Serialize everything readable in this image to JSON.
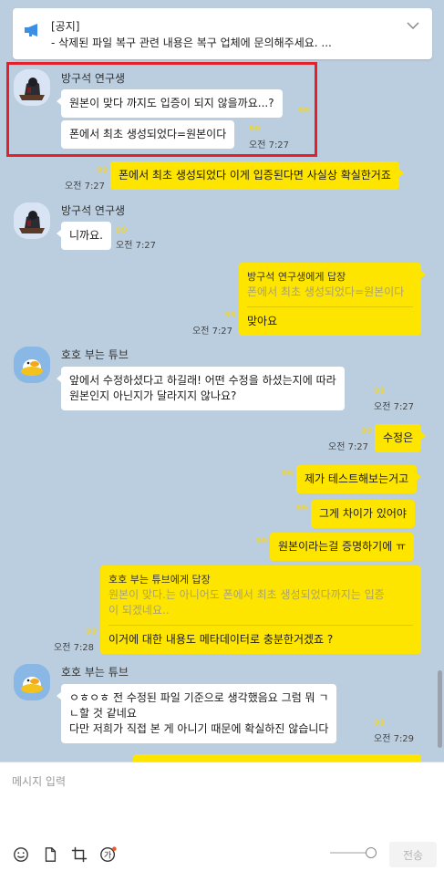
{
  "notice": {
    "title": "[공지]",
    "text": "- 삭제된 파일 복구 관련 내용은 복구 업체에 문의해주세요. ..."
  },
  "users": {
    "a": "방구석 연구생",
    "b": "호호 부는 튜브"
  },
  "unread_mark": "99",
  "messages": {
    "m1": "원본이 맞다 까지도 입증이 되지 않을까요...?",
    "m2": "폰에서 최초 생성되었다=원본이다",
    "m2_time": "오전 7:27",
    "m3": "폰에서 최초 생성되었다 이게 입증된다면 사실상 확실한거죠",
    "m3_time": "오전 7:27",
    "m4": "니까요.",
    "m4_time": "오전 7:27",
    "m5_reply_title": "방구석 연구생에게 답장",
    "m5_reply_quote": "폰에서 최초 생성되었다=원본이다",
    "m5_body": "맞아요",
    "m5_time": "오전 7:27",
    "m6_line1": "앞에서 수정하셨다고 하길래! 어떤 수정을 하셨는지에 따라",
    "m6_line2": "원본인지 아닌지가 달라지지 않나요?",
    "m6_time": "오전 7:27",
    "m7": "수정은",
    "m7_time": "오전 7:27",
    "m8": "제가 테스트해보는거고",
    "m9": "그게 차이가 있어야",
    "m10": "원본이라는걸 증명하기에 ㅠ",
    "m11_reply_title": "호호 부는 튜브에게 답장",
    "m11_reply_quote1": "원본이 맞다.는 아니어도 폰에서 최초 생성되었다까지는 입증",
    "m11_reply_quote2": "이 되겠네요..",
    "m11_body": "이거에 대한 내용도 메타데이터로 충분한거겠죠 ?",
    "m11_time": "오전 7:28",
    "m12_line1": "ㅇㅎㅇㅎ 전 수정된 파일 기준으로 생각했음요 그럼 뭐  ㄱ",
    "m12_line2": "ㄴ할 것 같네요",
    "m12_line3": "다만 저희가 직접 본 게 아니기 때문에 확실하진 않습니다",
    "m12_time": "오전 7:29"
  },
  "input": {
    "placeholder": "메시지 입력",
    "send_label": "전송",
    "translate_glyph": "가"
  },
  "colors": {
    "background": "#bacee0",
    "my_bubble": "#fee500",
    "other_bubble": "#ffffff",
    "highlight_box": "#e4212b",
    "notice_icon": "#3a8ee6"
  }
}
